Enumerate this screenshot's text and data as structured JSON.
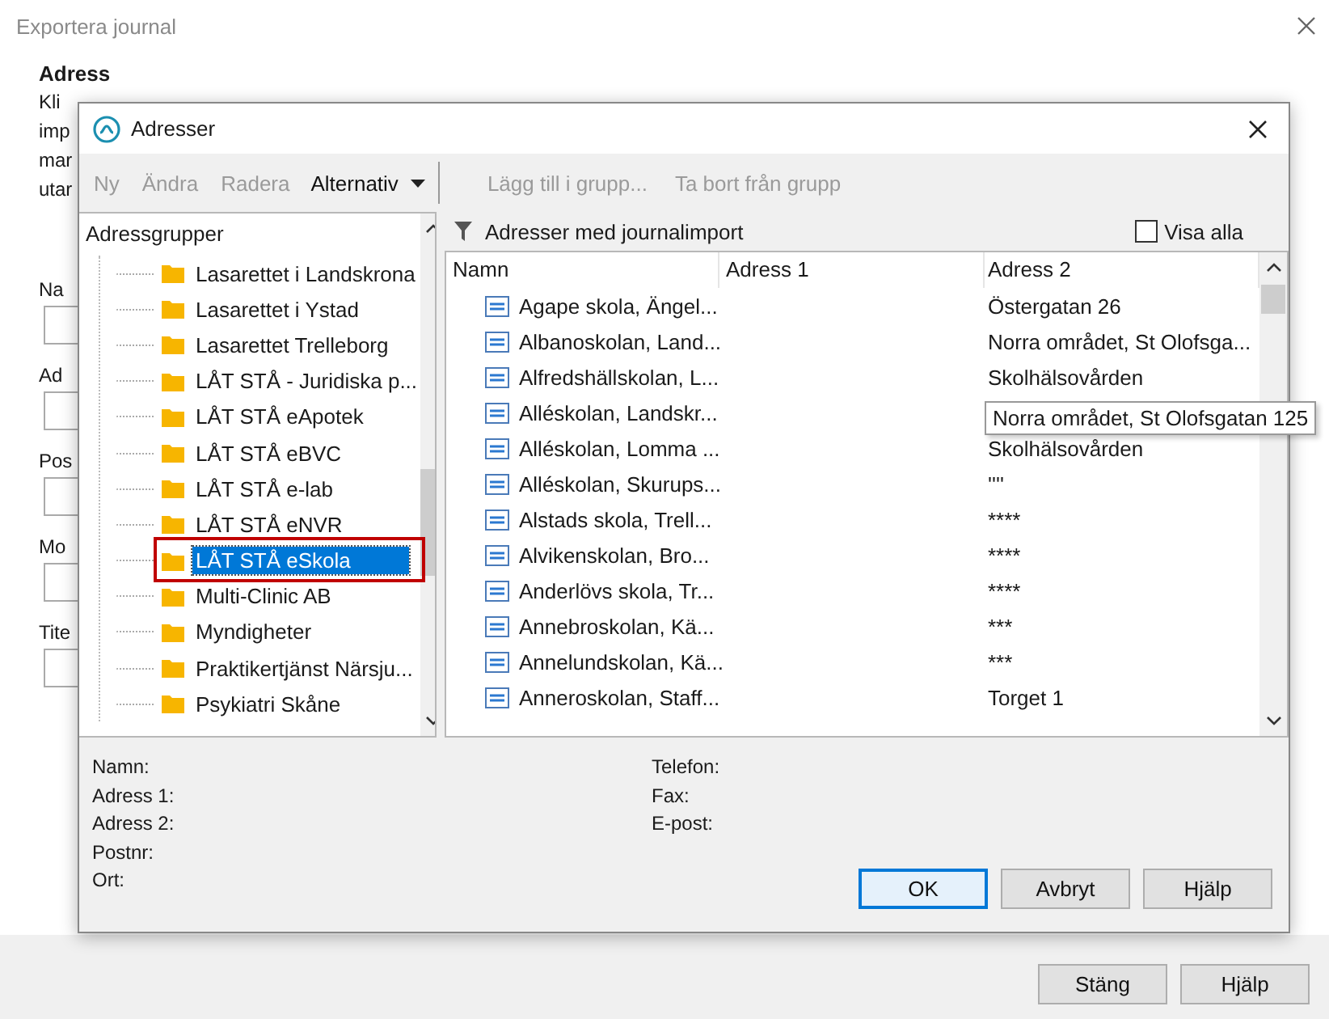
{
  "background_window": {
    "title": "Exportera journal",
    "section_heading": "Adress",
    "description_fragments": [
      "Kli",
      "imp",
      "mar",
      "utar"
    ],
    "field_label_fragments": [
      "Na",
      "Ad",
      "Pos",
      "Mo",
      "Tite"
    ],
    "buttons": [
      "Stäng",
      "Hjälp"
    ]
  },
  "dialog": {
    "title": "Adresser",
    "toolbar": {
      "left": [
        {
          "label": "Ny",
          "disabled": true,
          "kind": "button"
        },
        {
          "label": "Ändra",
          "disabled": true,
          "kind": "button"
        },
        {
          "label": "Radera",
          "disabled": true,
          "kind": "button"
        },
        {
          "label": "Alternativ",
          "disabled": false,
          "kind": "dropdown"
        }
      ],
      "right": [
        {
          "label": "Lägg till i grupp...",
          "disabled": true,
          "kind": "button"
        },
        {
          "label": "Ta bort från grupp",
          "disabled": true,
          "kind": "button"
        }
      ]
    },
    "groups_panel": {
      "heading": "Adressgrupper",
      "items": [
        {
          "label": "Lasarettet i Landskrona",
          "selected": false
        },
        {
          "label": "Lasarettet i Ystad",
          "selected": false
        },
        {
          "label": "Lasarettet Trelleborg",
          "selected": false
        },
        {
          "label": "LÅT STÅ - Juridiska p...",
          "selected": false
        },
        {
          "label": "LÅT STÅ eApotek",
          "selected": false
        },
        {
          "label": "LÅT STÅ eBVC",
          "selected": false
        },
        {
          "label": "LÅT STÅ e-lab",
          "selected": false
        },
        {
          "label": "LÅT STÅ eNVR",
          "selected": false
        },
        {
          "label": "LÅT STÅ eSkola",
          "selected": true
        },
        {
          "label": "Multi-Clinic AB",
          "selected": false
        },
        {
          "label": "Myndigheter",
          "selected": false
        },
        {
          "label": "Praktikertjänst Närsju...",
          "selected": false
        },
        {
          "label": "Psykiatri Skåne",
          "selected": false
        }
      ]
    },
    "address_panel": {
      "filter_label": "Adresser med journalimport",
      "show_all": {
        "label": "Visa alla",
        "checked": false
      },
      "columns": [
        "Namn",
        "Adress 1",
        "Adress 2"
      ],
      "rows": [
        {
          "name": "Agape skola, Ängel...",
          "address_2": "Östergatan 26"
        },
        {
          "name": "Albanoskolan, Land...",
          "address_2": "Norra området, St Olofsga..."
        },
        {
          "name": "Alfredshällskolan, L...",
          "address_2": "Skolhälsovården"
        },
        {
          "name": "Alléskolan, Landskr..."
        },
        {
          "name": "Alléskolan, Lomma ...",
          "address_2": "Skolhälsovården"
        },
        {
          "name": "Alléskolan, Skurups...",
          "address_2": "''''"
        },
        {
          "name": "Alstads skola, Trell...",
          "address_2": "****"
        },
        {
          "name": "Alvikenskolan, Bro...",
          "address_2": "****"
        },
        {
          "name": "Anderlövs skola, Tr...",
          "address_2": "****"
        },
        {
          "name": "Annebroskolan, Kä...",
          "address_2": "***"
        },
        {
          "name": "Annelundskolan, Kä...",
          "address_2": "***"
        },
        {
          "name": "Anneroskolan, Staff...",
          "address_2": "Torget 1"
        }
      ],
      "tooltip": "Norra området, St Olofsgatan 125"
    },
    "details": {
      "left_labels": [
        "Namn:",
        "Adress 1:",
        "Adress 2:",
        "Postnr:",
        "Ort:"
      ],
      "right_labels": [
        "Telefon:",
        "Fax:",
        "E-post:"
      ]
    },
    "buttons": [
      {
        "label": "OK",
        "default": true
      },
      {
        "label": "Avbryt",
        "default": false
      },
      {
        "label": "Hjälp",
        "default": false
      }
    ]
  }
}
